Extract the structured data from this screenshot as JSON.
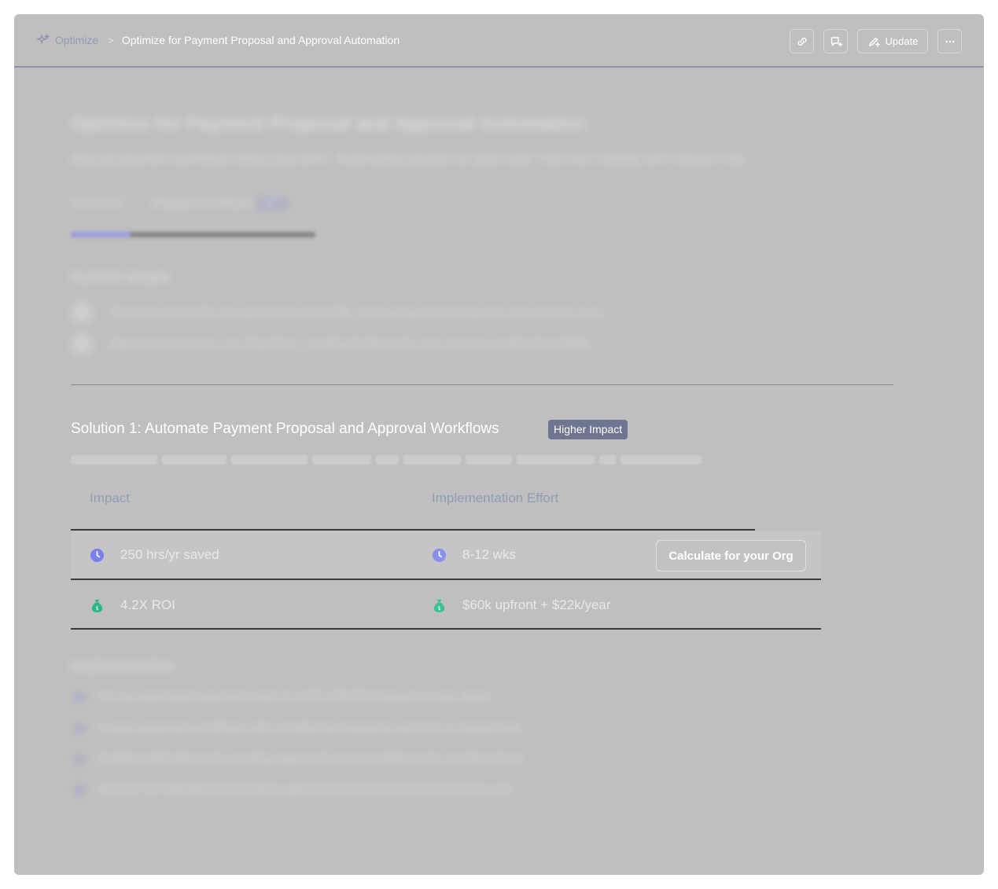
{
  "breadcrumb": {
    "root": "Optimize",
    "separator": ">",
    "current": "Optimize for Payment Proposal and Approval Automation"
  },
  "toolbar": {
    "update_label": "Update"
  },
  "background": {
    "title": "Optimize for Payment Proposal and Approval Automation",
    "subtitle": "Manual payment workflows delay payments. Automating speeds up approvals, improves visibility and reduces risk.",
    "tabs": [
      {
        "label": "Overview"
      },
      {
        "label": "Related workflows",
        "count": "4/7"
      }
    ],
    "issues_heading": "Current issues",
    "issues": [
      "Payment proposals are generated manually, increasing processing time and human error.",
      "Approval processes are disjointed, creating bottlenecks and reduced audit trail visibility."
    ],
    "implementation_heading": "Implementation",
    "steps": [
      "Set up automated payment rules in SAP S/4HANA based on due dates",
      "Create approval workflows with conditional routing by amount or department",
      "Enable notifications for pending approvals and escalations for overdue items",
      "Monitor KPI dashboards tracking approval turnaround and processing cost"
    ]
  },
  "solution": {
    "title": "Solution 1: Automate Payment Proposal and Approval Workflows",
    "badge": "Higher Impact",
    "table": {
      "headers": {
        "impact": "Impact",
        "effort": "Implementation Effort"
      },
      "rows": [
        {
          "impact_icon": "clock-icon",
          "impact": "250 hrs/yr saved",
          "effort_icon": "clock-icon",
          "effort": "8-12 wks"
        },
        {
          "impact_icon": "money-bag-icon",
          "impact": "4.2X ROI",
          "effort_icon": "money-bag-icon",
          "effort": "$60k upfront + $22k/year"
        }
      ],
      "calculate_label": "Calculate for your Org"
    }
  },
  "colors": {
    "overlay": "#bfbfbf",
    "accent": "#7b80f0",
    "money": "#2fb58a",
    "badge": "#6e7591"
  }
}
